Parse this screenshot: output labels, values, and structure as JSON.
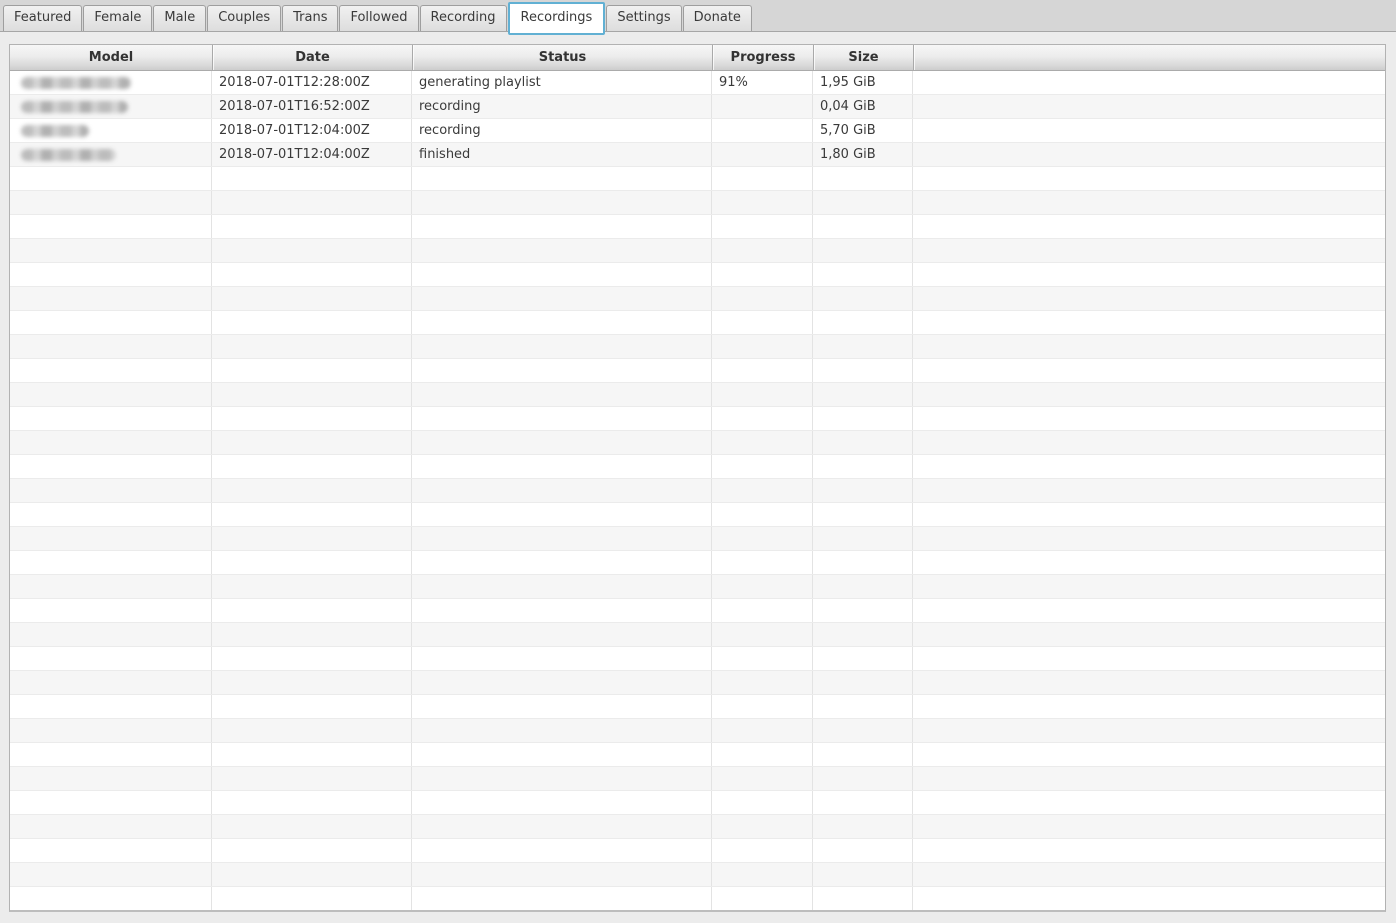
{
  "tab_bar": {
    "tabs": [
      "Featured",
      "Female",
      "Male",
      "Couples",
      "Trans",
      "Followed",
      "Recording",
      "Recordings",
      "Settings",
      "Donate"
    ],
    "active_tab": "Recordings"
  },
  "table": {
    "columns": [
      {
        "label": "Model"
      },
      {
        "label": "Date"
      },
      {
        "label": "Status"
      },
      {
        "label": "Progress"
      },
      {
        "label": "Size"
      },
      {
        "label": ""
      }
    ],
    "rows": [
      {
        "model_redacted": true,
        "model_blur_width": 110,
        "date": "2018-07-01T12:28:00Z",
        "status": "generating playlist",
        "progress": "91%",
        "size": "1,95 GiB"
      },
      {
        "model_redacted": true,
        "model_blur_width": 107,
        "date": "2018-07-01T16:52:00Z",
        "status": "recording",
        "progress": "",
        "size": "0,04 GiB"
      },
      {
        "model_redacted": true,
        "model_blur_width": 68,
        "date": "2018-07-01T12:04:00Z",
        "status": "recording",
        "progress": "",
        "size": "5,70 GiB"
      },
      {
        "model_redacted": true,
        "model_blur_width": 95,
        "date": "2018-07-01T12:04:00Z",
        "status": "finished",
        "progress": "",
        "size": "1,80 GiB"
      }
    ],
    "empty_row_count": 31
  },
  "colors": {
    "active_tab_border": "#61b0d3",
    "page_background": "#ececec",
    "row_stripe": "#f6f6f6"
  }
}
